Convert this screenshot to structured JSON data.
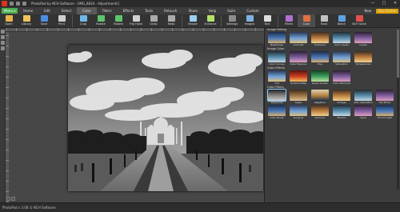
{
  "window": {
    "title": "PhotoPad by NCH Software - [IMG_8834 - Adjustments]",
    "controls": [
      "—",
      "□",
      "✕"
    ]
  },
  "menu": {
    "menu_button": "Menu ▾",
    "tabs": [
      "Home",
      "Edit",
      "Select",
      "Color",
      "Filters",
      "Effects",
      "Tools",
      "Retouch",
      "Share",
      "Help",
      "Suite",
      "Custom"
    ],
    "active_tab": "Color",
    "right": {
      "new": "New",
      "buy": "Buy Online"
    }
  },
  "ribbon": {
    "buttons": [
      {
        "label": "Open",
        "color": "#e8b24a"
      },
      {
        "label": "Library",
        "color": "#f0c45a"
      },
      {
        "label": "Save",
        "color": "#4a8fe0"
      },
      {
        "label": "Print",
        "color": "#cfcfcf"
      },
      {
        "label": "Crop",
        "color": "#6fb8e8"
      },
      {
        "label": "Rotate",
        "color": "#5cc46a"
      },
      {
        "label": "Rotate",
        "color": "#5cc46a"
      },
      {
        "label": "Flip Horiz",
        "color": "#d0d0d0"
      },
      {
        "label": "Undo",
        "color": "#aaaaaa"
      },
      {
        "label": "Redo",
        "color": "#aaaaaa"
      },
      {
        "label": "Resize",
        "color": "#9ad0f0"
      },
      {
        "label": "Enhance",
        "color": "#b4e06a"
      },
      {
        "label": "Settings",
        "color": "#8c8c8c"
      },
      {
        "label": "Images",
        "color": "#7fb3e0"
      },
      {
        "label": "Text",
        "color": "#dddddd"
      },
      {
        "label": "Filters",
        "color": "#b070d0"
      },
      {
        "label": "Color",
        "color": "#e07040"
      },
      {
        "label": "Tools",
        "color": "#c0c0c0"
      },
      {
        "label": "Batch",
        "color": "#60a0e0"
      },
      {
        "label": "NCH Suite",
        "color": "#e05050"
      }
    ]
  },
  "panel": {
    "sections": [
      {
        "title": "Image Editing",
        "items": [
          "Brightness",
          "Contrast",
          "Exposure",
          "Auto Levels",
          "Levels"
        ],
        "selected": ""
      },
      {
        "title": "Image Color",
        "items": [
          "Color Curves",
          "Color Balance",
          "Hue",
          "Saturation",
          "Temperature"
        ],
        "selected": ""
      },
      {
        "title": "Color Effects",
        "items": [
          "Tint",
          "Gradient Map",
          "Green Screen",
          "Color Removal"
        ],
        "selected": ""
      },
      {
        "title": "Color Filters",
        "items": [
          "Greyscale",
          "Sepia",
          "Negative",
          "Vintage",
          "Auto Saturation",
          "Old Photo",
          "Color Boost",
          "Sunglow",
          "Summer",
          "Electric",
          "Aqua",
          "Orchid Light"
        ],
        "selected": "Greyscale"
      }
    ]
  },
  "status": {
    "text": "PhotoPad v 3.08 © NCH Software"
  }
}
